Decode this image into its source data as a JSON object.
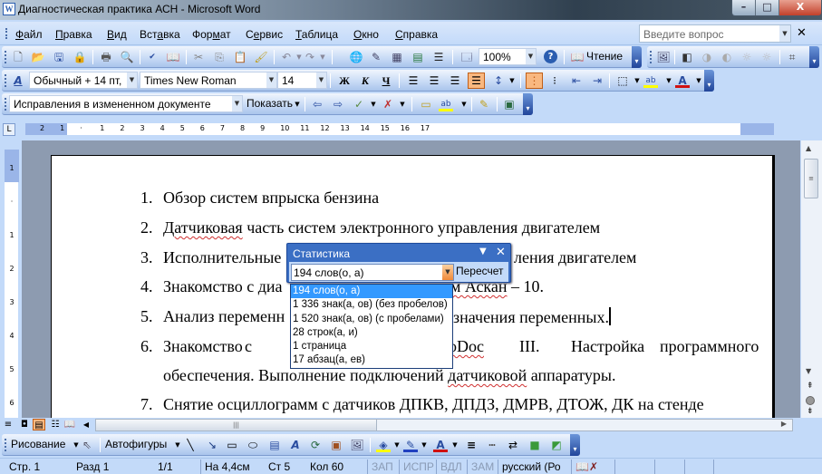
{
  "window": {
    "title": "Диагностическая практика АСН - Microsoft Word",
    "app_icon": "word-icon",
    "controls": {
      "minimize": "–",
      "maximize": "□",
      "close": "X"
    }
  },
  "menubar": {
    "items": [
      "Файл",
      "Правка",
      "Вид",
      "Вставка",
      "Формат",
      "Сервис",
      "Таблица",
      "Окно",
      "Справка"
    ],
    "ask_placeholder": "Введите вопрос",
    "close_glyph": "✕"
  },
  "standard_toolbar": {
    "icons": [
      "new-document-icon",
      "open-icon",
      "save-icon",
      "permission-icon",
      "print-icon",
      "print-preview-icon",
      "spelling-icon",
      "research-icon",
      "cut-icon",
      "copy-icon",
      "paste-icon",
      "format-painter-icon",
      "undo-icon",
      "redo-icon",
      "hyperlink-icon",
      "tables-borders-icon",
      "insert-table-icon",
      "insert-excel-icon",
      "columns-icon",
      "document-map-icon"
    ],
    "zoom": "100%",
    "reading_label": "Чтение"
  },
  "formatting_toolbar": {
    "style": "Обычный + 14 пт,",
    "font": "Times New Roman",
    "size": "14",
    "bold": "Ж",
    "italic": "К",
    "underline": "Ч",
    "font_color": "#d01010",
    "highlight_color": "#ffff00"
  },
  "reviewing_toolbar": {
    "display_mode": "Исправления в измененном документе",
    "show_label": "Показать"
  },
  "ruler": {
    "unit_labels": [
      "2",
      "1",
      "",
      "1",
      "2",
      "3",
      "4",
      "5",
      "6",
      "7",
      "8",
      "9",
      "10",
      "11",
      "12",
      "13",
      "14",
      "15",
      "16",
      "17"
    ],
    "vertical_labels": [
      "1",
      "",
      "1",
      "2",
      "3",
      "4",
      "5",
      "6"
    ]
  },
  "document": {
    "items": [
      {
        "num": "1.",
        "text": "Обзор систем впрыска бензина"
      },
      {
        "num": "2.",
        "text_parts": [
          "Датчиковая",
          " часть систем электронного управления двигателем"
        ]
      },
      {
        "num": "3.",
        "text_left": "Исполнительные",
        "text_right": "ления двигателем"
      },
      {
        "num": "4.",
        "text_left": "Знакомство с диа",
        "text_right": "м Аскан",
        "text_tail": " – 10."
      },
      {
        "num": "5.",
        "text_left": "Анализ переменн",
        "text_right": "значения переменных."
      },
      {
        "num": "6.",
        "words": [
          "Знакомство",
          "с",
          "",
          "oDoc",
          "III.",
          "Настройка",
          "программного"
        ]
      },
      {
        "cont": true,
        "text_left": "обеспечения. Выполнение подключений ",
        "text_wavy": "датчиковой",
        "text_right": " аппаратуры."
      },
      {
        "num": "7.",
        "text": "Снятие осциллограмм с  датчиков ДПКВ, ДПДЗ, ДМРВ, ДТОЖ, ДК на стенде"
      }
    ]
  },
  "statistics_toolbar": {
    "title": "Статистика",
    "selected": "194 слов(о, а)",
    "recalc_label": "Пересчет",
    "options": [
      "194 слов(о, а)",
      "1 336 знак(а, ов) (без пробелов)",
      "1 520 знак(а, ов) (с пробелами)",
      "28 строк(а, и)",
      "1 страница",
      "17 абзац(а, ев)"
    ]
  },
  "drawing_toolbar": {
    "drawing_label": "Рисование",
    "autoshapes_label": "Автофигуры"
  },
  "statusbar": {
    "page": "Стр. 1",
    "section": "Разд 1",
    "pages": "1/1",
    "at": "На 4,4см",
    "line": "Ст 5",
    "col": "Кол 60",
    "rec": "ЗАП",
    "trk": "ИСПР",
    "ext": "ВДЛ",
    "ovr": "ЗАМ",
    "language": "русский (Ро"
  }
}
